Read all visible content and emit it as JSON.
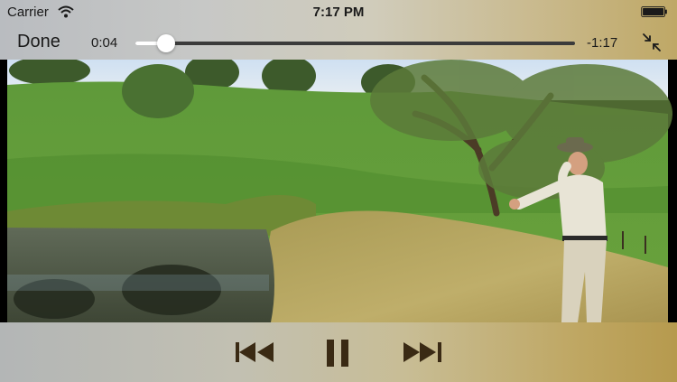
{
  "status_bar": {
    "carrier": "Carrier",
    "time": "7:17 PM",
    "wifi_icon": "wifi-icon",
    "battery_icon": "battery-icon"
  },
  "player": {
    "done_label": "Done",
    "elapsed": "0:04",
    "remaining": "-1:17",
    "progress_fraction": 0.07,
    "exit_fullscreen_icon": "exit-fullscreen-icon"
  },
  "controls": {
    "previous_icon": "skip-back-icon",
    "pause_icon": "pause-icon",
    "next_icon": "skip-forward-icon",
    "icon_color": "#3a2a14"
  }
}
